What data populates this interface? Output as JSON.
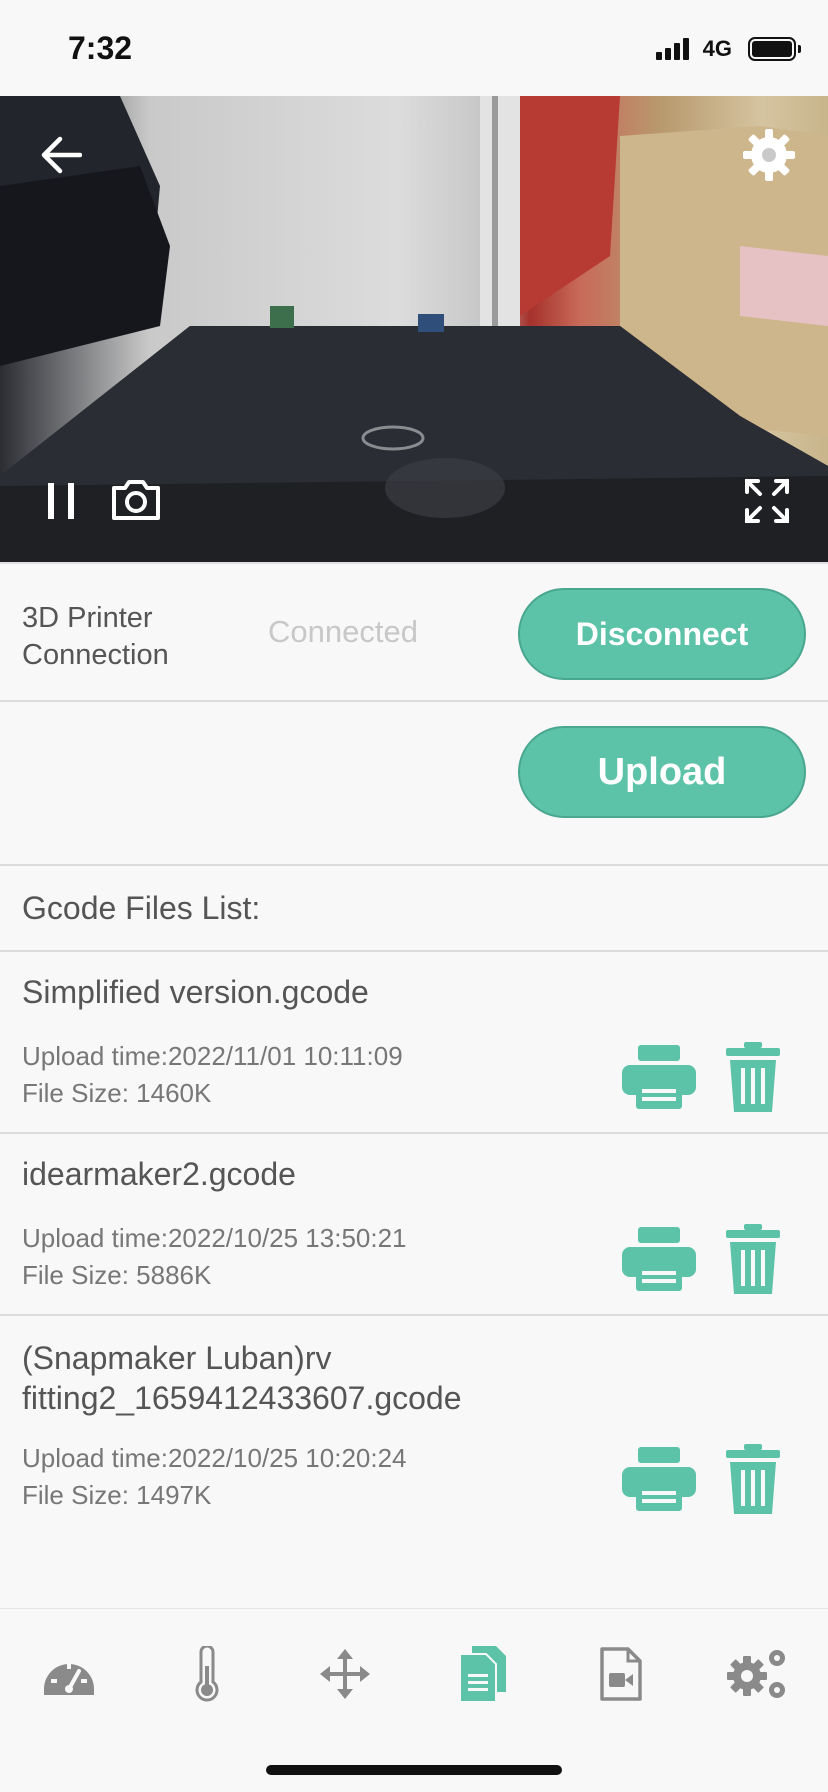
{
  "status_bar": {
    "time": "7:32",
    "network": "4G"
  },
  "connection": {
    "label": "3D Printer Connection",
    "status": "Connected",
    "disconnect_label": "Disconnect"
  },
  "upload": {
    "label": "Upload"
  },
  "files": {
    "header": "Gcode Files List:",
    "items": [
      {
        "name": "Simplified version.gcode",
        "upload_time": "Upload time:2022/11/01 10:11:09",
        "size": "File Size: 1460K"
      },
      {
        "name": "idearmaker2.gcode",
        "upload_time": "Upload time:2022/10/25 13:50:21",
        "size": "File Size: 5886K"
      },
      {
        "name": "(Snapmaker Luban)rv fitting2_1659412433607.gcode",
        "upload_time": "Upload time:2022/10/25 10:20:24",
        "size": "File Size: 1497K"
      }
    ]
  },
  "colors": {
    "accent": "#5cc2a8",
    "nav_inactive": "#8a8a8a",
    "nav_active": "#5cc2a8"
  },
  "icons": {
    "camera_controls": [
      "back-arrow-icon",
      "settings-gear-icon",
      "pause-icon",
      "snapshot-camera-icon",
      "fullscreen-icon"
    ],
    "file_actions": [
      "printer-icon",
      "trash-icon"
    ],
    "nav": [
      "gauge-icon",
      "thermometer-icon",
      "move-arrows-icon",
      "files-icon",
      "video-file-icon",
      "settings-gears-icon"
    ],
    "active_nav": "files-icon"
  }
}
